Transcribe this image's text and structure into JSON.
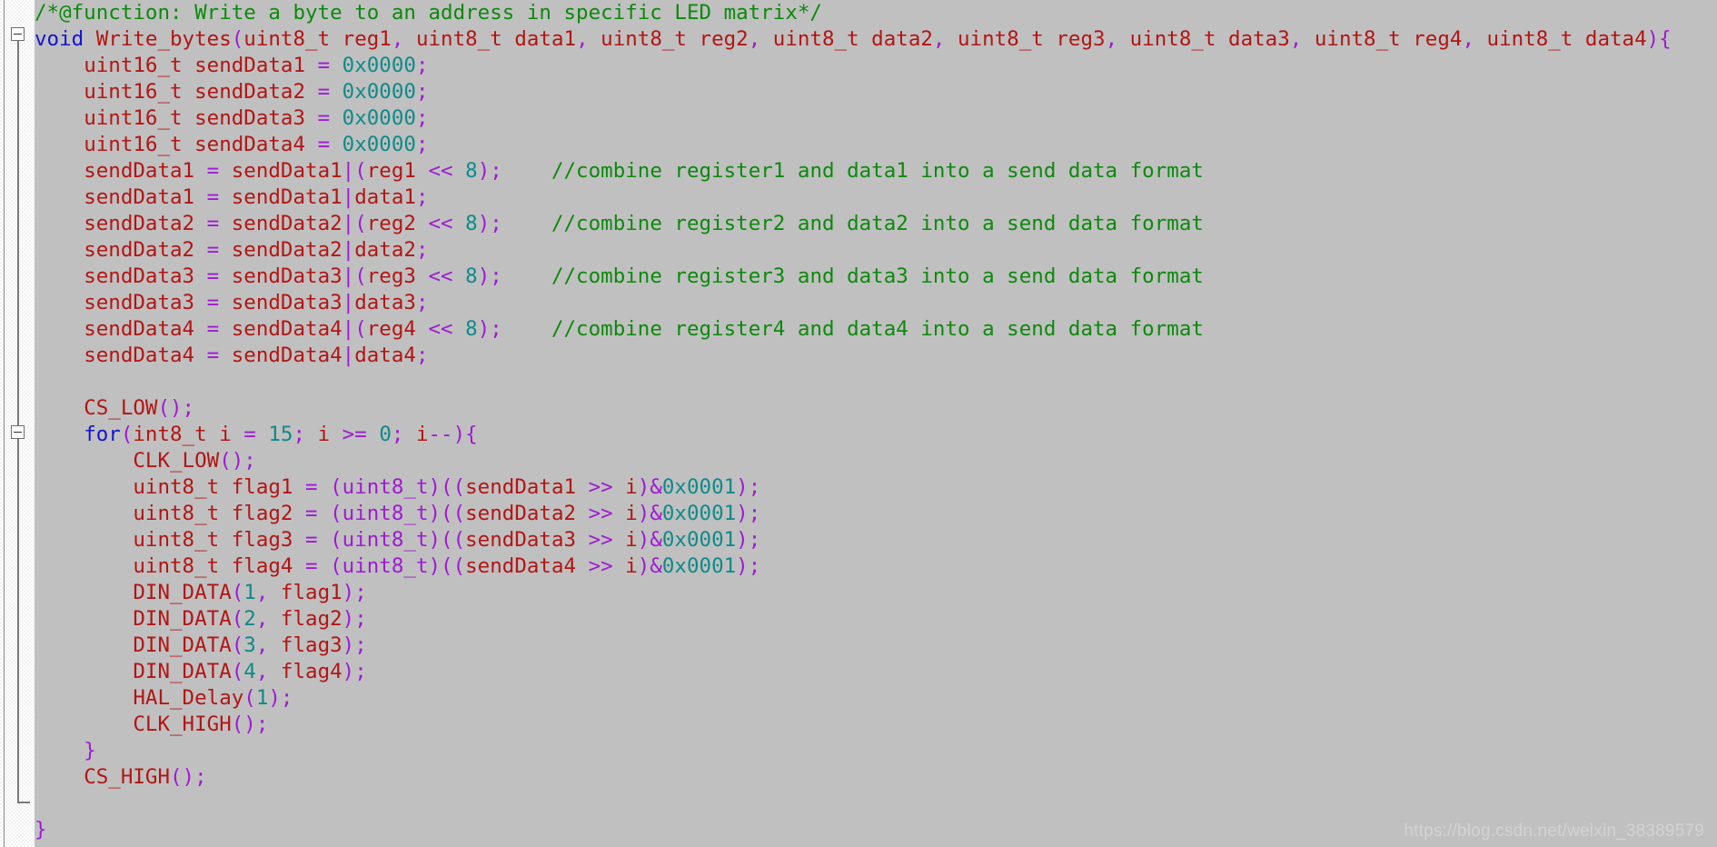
{
  "editor": {
    "background_color": "#c0c0c0",
    "gutter_color": "#ffffff",
    "language": "C",
    "font": "monospace"
  },
  "palette": {
    "comment": "#0b8a0b",
    "keyword": "#1414cf",
    "identifier": "#b31515",
    "operator": "#a019d6",
    "number": "#0f8a8a",
    "background": "#c0c0c0",
    "watermark": "#d3d3d3"
  },
  "gutter": {
    "fold_markers": [
      {
        "name": "fold-marker-function",
        "glyph": "minus-box",
        "line": 2,
        "expanded": true
      },
      {
        "name": "fold-marker-for-loop",
        "glyph": "minus-box",
        "line": 17,
        "expanded": true
      }
    ]
  },
  "watermark": {
    "text": "https://blog.csdn.net/weixin_38389579"
  },
  "code": {
    "lines": [
      {
        "n": 1,
        "tokens": [
          {
            "t": "cmt",
            "v": "/*@function: Write a byte to an address in specific LED matrix*/"
          }
        ]
      },
      {
        "n": 2,
        "tokens": [
          {
            "t": "kw",
            "v": "void"
          },
          {
            "t": "pl",
            "v": " "
          },
          {
            "t": "id",
            "v": "Write_bytes"
          },
          {
            "t": "op",
            "v": "("
          },
          {
            "t": "id",
            "v": "uint8_t reg1"
          },
          {
            "t": "op",
            "v": ","
          },
          {
            "t": "id",
            "v": " uint8_t data1"
          },
          {
            "t": "op",
            "v": ","
          },
          {
            "t": "id",
            "v": " uint8_t reg2"
          },
          {
            "t": "op",
            "v": ","
          },
          {
            "t": "id",
            "v": " uint8_t data2"
          },
          {
            "t": "op",
            "v": ","
          },
          {
            "t": "id",
            "v": " uint8_t reg3"
          },
          {
            "t": "op",
            "v": ","
          },
          {
            "t": "id",
            "v": " uint8_t data3"
          },
          {
            "t": "op",
            "v": ","
          },
          {
            "t": "id",
            "v": " uint8_t reg4"
          },
          {
            "t": "op",
            "v": ","
          },
          {
            "t": "id",
            "v": " uint8_t data4"
          },
          {
            "t": "op",
            "v": "){"
          }
        ]
      },
      {
        "n": 3,
        "tokens": [
          {
            "t": "pl",
            "v": "    "
          },
          {
            "t": "id",
            "v": "uint16_t sendData1 "
          },
          {
            "t": "op",
            "v": "="
          },
          {
            "t": "pl",
            "v": " "
          },
          {
            "t": "num",
            "v": "0x0000"
          },
          {
            "t": "op",
            "v": ";"
          }
        ]
      },
      {
        "n": 4,
        "tokens": [
          {
            "t": "pl",
            "v": "    "
          },
          {
            "t": "id",
            "v": "uint16_t sendData2 "
          },
          {
            "t": "op",
            "v": "="
          },
          {
            "t": "pl",
            "v": " "
          },
          {
            "t": "num",
            "v": "0x0000"
          },
          {
            "t": "op",
            "v": ";"
          }
        ]
      },
      {
        "n": 5,
        "tokens": [
          {
            "t": "pl",
            "v": "    "
          },
          {
            "t": "id",
            "v": "uint16_t sendData3 "
          },
          {
            "t": "op",
            "v": "="
          },
          {
            "t": "pl",
            "v": " "
          },
          {
            "t": "num",
            "v": "0x0000"
          },
          {
            "t": "op",
            "v": ";"
          }
        ]
      },
      {
        "n": 6,
        "tokens": [
          {
            "t": "pl",
            "v": "    "
          },
          {
            "t": "id",
            "v": "uint16_t sendData4 "
          },
          {
            "t": "op",
            "v": "="
          },
          {
            "t": "pl",
            "v": " "
          },
          {
            "t": "num",
            "v": "0x0000"
          },
          {
            "t": "op",
            "v": ";"
          }
        ]
      },
      {
        "n": 7,
        "tokens": [
          {
            "t": "pl",
            "v": "    "
          },
          {
            "t": "id",
            "v": "sendData1 "
          },
          {
            "t": "op",
            "v": "="
          },
          {
            "t": "id",
            "v": " sendData1"
          },
          {
            "t": "op",
            "v": "|("
          },
          {
            "t": "id",
            "v": "reg1 "
          },
          {
            "t": "op",
            "v": "<<"
          },
          {
            "t": "pl",
            "v": " "
          },
          {
            "t": "num",
            "v": "8"
          },
          {
            "t": "op",
            "v": ");"
          },
          {
            "t": "pl",
            "v": "    "
          },
          {
            "t": "cmt",
            "v": "//combine register1 and data1 into a send data format"
          }
        ]
      },
      {
        "n": 8,
        "tokens": [
          {
            "t": "pl",
            "v": "    "
          },
          {
            "t": "id",
            "v": "sendData1 "
          },
          {
            "t": "op",
            "v": "="
          },
          {
            "t": "id",
            "v": " sendData1"
          },
          {
            "t": "op",
            "v": "|"
          },
          {
            "t": "id",
            "v": "data1"
          },
          {
            "t": "op",
            "v": ";"
          }
        ]
      },
      {
        "n": 9,
        "tokens": [
          {
            "t": "pl",
            "v": "    "
          },
          {
            "t": "id",
            "v": "sendData2 "
          },
          {
            "t": "op",
            "v": "="
          },
          {
            "t": "id",
            "v": " sendData2"
          },
          {
            "t": "op",
            "v": "|("
          },
          {
            "t": "id",
            "v": "reg2 "
          },
          {
            "t": "op",
            "v": "<<"
          },
          {
            "t": "pl",
            "v": " "
          },
          {
            "t": "num",
            "v": "8"
          },
          {
            "t": "op",
            "v": ");"
          },
          {
            "t": "pl",
            "v": "    "
          },
          {
            "t": "cmt",
            "v": "//combine register2 and data2 into a send data format"
          }
        ]
      },
      {
        "n": 10,
        "tokens": [
          {
            "t": "pl",
            "v": "    "
          },
          {
            "t": "id",
            "v": "sendData2 "
          },
          {
            "t": "op",
            "v": "="
          },
          {
            "t": "id",
            "v": " sendData2"
          },
          {
            "t": "op",
            "v": "|"
          },
          {
            "t": "id",
            "v": "data2"
          },
          {
            "t": "op",
            "v": ";"
          }
        ]
      },
      {
        "n": 11,
        "tokens": [
          {
            "t": "pl",
            "v": "    "
          },
          {
            "t": "id",
            "v": "sendData3 "
          },
          {
            "t": "op",
            "v": "="
          },
          {
            "t": "id",
            "v": " sendData3"
          },
          {
            "t": "op",
            "v": "|("
          },
          {
            "t": "id",
            "v": "reg3 "
          },
          {
            "t": "op",
            "v": "<<"
          },
          {
            "t": "pl",
            "v": " "
          },
          {
            "t": "num",
            "v": "8"
          },
          {
            "t": "op",
            "v": ");"
          },
          {
            "t": "pl",
            "v": "    "
          },
          {
            "t": "cmt",
            "v": "//combine register3 and data3 into a send data format"
          }
        ]
      },
      {
        "n": 12,
        "tokens": [
          {
            "t": "pl",
            "v": "    "
          },
          {
            "t": "id",
            "v": "sendData3 "
          },
          {
            "t": "op",
            "v": "="
          },
          {
            "t": "id",
            "v": " sendData3"
          },
          {
            "t": "op",
            "v": "|"
          },
          {
            "t": "id",
            "v": "data3"
          },
          {
            "t": "op",
            "v": ";"
          }
        ]
      },
      {
        "n": 13,
        "tokens": [
          {
            "t": "pl",
            "v": "    "
          },
          {
            "t": "id",
            "v": "sendData4 "
          },
          {
            "t": "op",
            "v": "="
          },
          {
            "t": "id",
            "v": " sendData4"
          },
          {
            "t": "op",
            "v": "|("
          },
          {
            "t": "id",
            "v": "reg4 "
          },
          {
            "t": "op",
            "v": "<<"
          },
          {
            "t": "pl",
            "v": " "
          },
          {
            "t": "num",
            "v": "8"
          },
          {
            "t": "op",
            "v": ");"
          },
          {
            "t": "pl",
            "v": "    "
          },
          {
            "t": "cmt",
            "v": "//combine register4 and data4 into a send data format"
          }
        ]
      },
      {
        "n": 14,
        "tokens": [
          {
            "t": "pl",
            "v": "    "
          },
          {
            "t": "id",
            "v": "sendData4 "
          },
          {
            "t": "op",
            "v": "="
          },
          {
            "t": "id",
            "v": " sendData4"
          },
          {
            "t": "op",
            "v": "|"
          },
          {
            "t": "id",
            "v": "data4"
          },
          {
            "t": "op",
            "v": ";"
          }
        ]
      },
      {
        "n": 15,
        "tokens": [
          {
            "t": "pl",
            "v": ""
          }
        ]
      },
      {
        "n": 16,
        "tokens": [
          {
            "t": "pl",
            "v": "    "
          },
          {
            "t": "id",
            "v": "CS_LOW"
          },
          {
            "t": "op",
            "v": "();"
          }
        ]
      },
      {
        "n": 17,
        "tokens": [
          {
            "t": "pl",
            "v": "    "
          },
          {
            "t": "kw",
            "v": "for"
          },
          {
            "t": "op",
            "v": "("
          },
          {
            "t": "id",
            "v": "int8_t i "
          },
          {
            "t": "op",
            "v": "="
          },
          {
            "t": "pl",
            "v": " "
          },
          {
            "t": "num",
            "v": "15"
          },
          {
            "t": "op",
            "v": ";"
          },
          {
            "t": "id",
            "v": " i "
          },
          {
            "t": "op",
            "v": ">="
          },
          {
            "t": "pl",
            "v": " "
          },
          {
            "t": "num",
            "v": "0"
          },
          {
            "t": "op",
            "v": ";"
          },
          {
            "t": "id",
            "v": " i"
          },
          {
            "t": "op",
            "v": "--){"
          }
        ]
      },
      {
        "n": 18,
        "tokens": [
          {
            "t": "pl",
            "v": "        "
          },
          {
            "t": "id",
            "v": "CLK_LOW"
          },
          {
            "t": "op",
            "v": "();"
          }
        ]
      },
      {
        "n": 19,
        "tokens": [
          {
            "t": "pl",
            "v": "        "
          },
          {
            "t": "id",
            "v": "uint8_t flag1 "
          },
          {
            "t": "op",
            "v": "= (uint8_t)(("
          },
          {
            "t": "id",
            "v": "sendData1 "
          },
          {
            "t": "op",
            "v": ">>"
          },
          {
            "t": "id",
            "v": " i"
          },
          {
            "t": "op",
            "v": ")&"
          },
          {
            "t": "num",
            "v": "0x0001"
          },
          {
            "t": "op",
            "v": ");"
          }
        ]
      },
      {
        "n": 20,
        "tokens": [
          {
            "t": "pl",
            "v": "        "
          },
          {
            "t": "id",
            "v": "uint8_t flag2 "
          },
          {
            "t": "op",
            "v": "= (uint8_t)(("
          },
          {
            "t": "id",
            "v": "sendData2 "
          },
          {
            "t": "op",
            "v": ">>"
          },
          {
            "t": "id",
            "v": " i"
          },
          {
            "t": "op",
            "v": ")&"
          },
          {
            "t": "num",
            "v": "0x0001"
          },
          {
            "t": "op",
            "v": ");"
          }
        ]
      },
      {
        "n": 21,
        "tokens": [
          {
            "t": "pl",
            "v": "        "
          },
          {
            "t": "id",
            "v": "uint8_t flag3 "
          },
          {
            "t": "op",
            "v": "= (uint8_t)(("
          },
          {
            "t": "id",
            "v": "sendData3 "
          },
          {
            "t": "op",
            "v": ">>"
          },
          {
            "t": "id",
            "v": " i"
          },
          {
            "t": "op",
            "v": ")&"
          },
          {
            "t": "num",
            "v": "0x0001"
          },
          {
            "t": "op",
            "v": ");"
          }
        ]
      },
      {
        "n": 22,
        "tokens": [
          {
            "t": "pl",
            "v": "        "
          },
          {
            "t": "id",
            "v": "uint8_t flag4 "
          },
          {
            "t": "op",
            "v": "= (uint8_t)(("
          },
          {
            "t": "id",
            "v": "sendData4 "
          },
          {
            "t": "op",
            "v": ">>"
          },
          {
            "t": "id",
            "v": " i"
          },
          {
            "t": "op",
            "v": ")&"
          },
          {
            "t": "num",
            "v": "0x0001"
          },
          {
            "t": "op",
            "v": ");"
          }
        ]
      },
      {
        "n": 23,
        "tokens": [
          {
            "t": "pl",
            "v": "        "
          },
          {
            "t": "id",
            "v": "DIN_DATA"
          },
          {
            "t": "op",
            "v": "("
          },
          {
            "t": "num",
            "v": "1"
          },
          {
            "t": "op",
            "v": ","
          },
          {
            "t": "id",
            "v": " flag1"
          },
          {
            "t": "op",
            "v": ");"
          }
        ]
      },
      {
        "n": 24,
        "tokens": [
          {
            "t": "pl",
            "v": "        "
          },
          {
            "t": "id",
            "v": "DIN_DATA"
          },
          {
            "t": "op",
            "v": "("
          },
          {
            "t": "num",
            "v": "2"
          },
          {
            "t": "op",
            "v": ","
          },
          {
            "t": "id",
            "v": " flag2"
          },
          {
            "t": "op",
            "v": ");"
          }
        ]
      },
      {
        "n": 25,
        "tokens": [
          {
            "t": "pl",
            "v": "        "
          },
          {
            "t": "id",
            "v": "DIN_DATA"
          },
          {
            "t": "op",
            "v": "("
          },
          {
            "t": "num",
            "v": "3"
          },
          {
            "t": "op",
            "v": ","
          },
          {
            "t": "id",
            "v": " flag3"
          },
          {
            "t": "op",
            "v": ");"
          }
        ]
      },
      {
        "n": 26,
        "tokens": [
          {
            "t": "pl",
            "v": "        "
          },
          {
            "t": "id",
            "v": "DIN_DATA"
          },
          {
            "t": "op",
            "v": "("
          },
          {
            "t": "num",
            "v": "4"
          },
          {
            "t": "op",
            "v": ","
          },
          {
            "t": "id",
            "v": " flag4"
          },
          {
            "t": "op",
            "v": ");"
          }
        ]
      },
      {
        "n": 27,
        "tokens": [
          {
            "t": "pl",
            "v": "        "
          },
          {
            "t": "id",
            "v": "HAL_Delay"
          },
          {
            "t": "op",
            "v": "("
          },
          {
            "t": "num",
            "v": "1"
          },
          {
            "t": "op",
            "v": ");"
          }
        ]
      },
      {
        "n": 28,
        "tokens": [
          {
            "t": "pl",
            "v": "        "
          },
          {
            "t": "id",
            "v": "CLK_HIGH"
          },
          {
            "t": "op",
            "v": "();"
          }
        ]
      },
      {
        "n": 29,
        "tokens": [
          {
            "t": "pl",
            "v": "    "
          },
          {
            "t": "op",
            "v": "}"
          }
        ]
      },
      {
        "n": 30,
        "tokens": [
          {
            "t": "pl",
            "v": "    "
          },
          {
            "t": "id",
            "v": "CS_HIGH"
          },
          {
            "t": "op",
            "v": "();"
          }
        ]
      },
      {
        "n": 31,
        "tokens": [
          {
            "t": "pl",
            "v": ""
          }
        ]
      },
      {
        "n": 32,
        "tokens": [
          {
            "t": "op",
            "v": "}"
          }
        ]
      }
    ]
  }
}
